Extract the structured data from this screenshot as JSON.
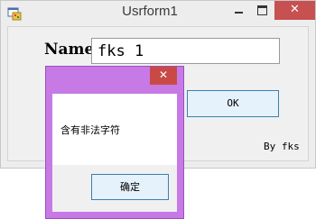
{
  "window": {
    "title": "Usrform1",
    "app_icon": "form-app-icon",
    "controls": {
      "minimize_icon": "minimize-icon",
      "maximize_icon": "maximize-icon",
      "close_glyph": "✕"
    }
  },
  "form": {
    "name_label": "Name",
    "name_value": "fks 1",
    "ok_button": "OK",
    "by_label": "By fks"
  },
  "message_box": {
    "close_glyph": "✕",
    "message": "含有非法字符",
    "confirm_button": "确定",
    "frame_color": "#c77ae6",
    "close_color": "#c94a44"
  },
  "colors": {
    "window_bg": "#ededed",
    "close_button": "#c75050",
    "button_accent": "#3c7fb1"
  }
}
